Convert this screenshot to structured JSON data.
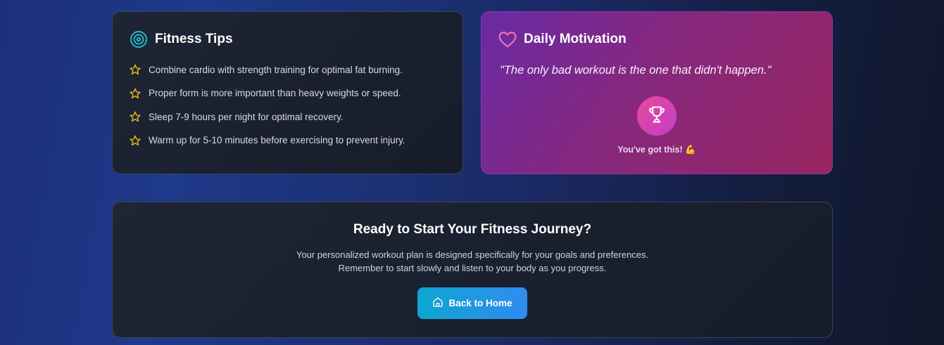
{
  "fitness_tips": {
    "title": "Fitness Tips",
    "icon": "target-icon",
    "items": [
      "Combine cardio with strength training for optimal fat burning.",
      "Proper form is more important than heavy weights or speed.",
      "Sleep 7-9 hours per night for optimal recovery.",
      "Warm up for 5-10 minutes before exercising to prevent injury."
    ],
    "item_icon": "star-icon",
    "accent": "#22b8cf",
    "star_color": "#f5c518"
  },
  "daily_motivation": {
    "title": "Daily Motivation",
    "icon": "heart-icon",
    "quote": "\"The only bad workout is the one that didn't happen.\"",
    "badge_icon": "trophy-icon",
    "cheer": "You've got this! 💪"
  },
  "cta": {
    "title": "Ready to Start Your Fitness Journey?",
    "line1": "Your personalized workout plan is designed specifically for your goals and preferences.",
    "line2": "Remember to start slowly and listen to your body as you progress.",
    "button_label": "Back to Home",
    "button_icon": "home-icon"
  }
}
